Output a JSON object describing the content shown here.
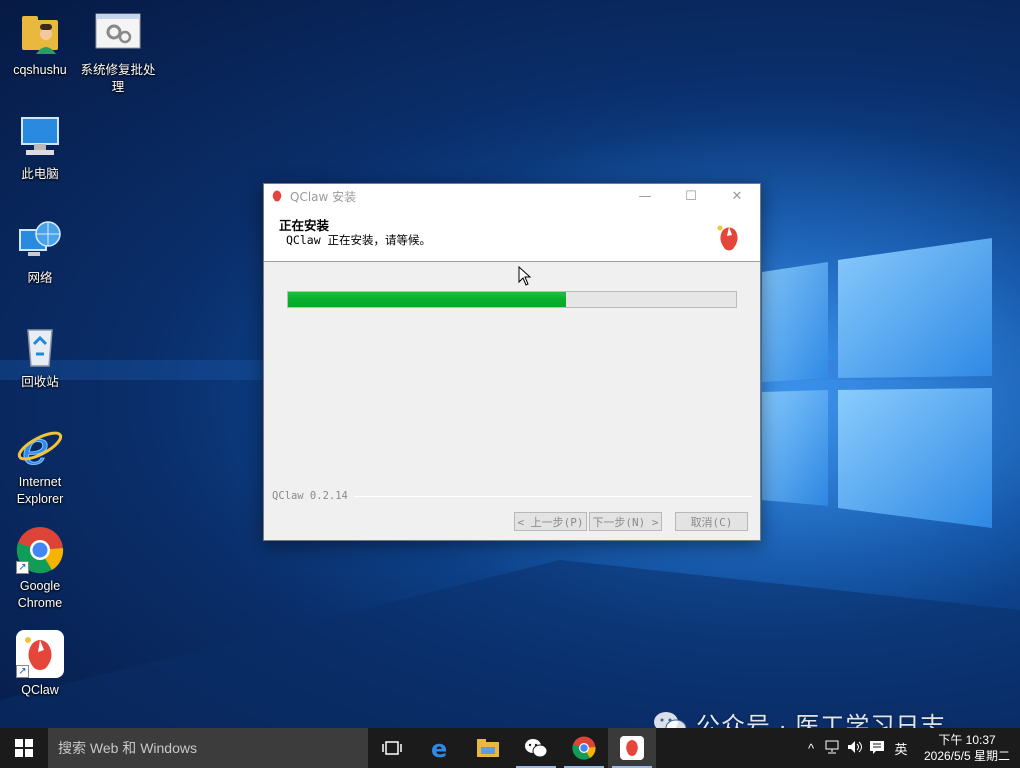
{
  "desktop": {
    "icons": [
      {
        "label": "cqshushu",
        "icon": "user-folder-icon"
      },
      {
        "label": "系统修复批处\n理",
        "icon": "batch-file-icon"
      },
      {
        "label": "此电脑",
        "icon": "computer-icon"
      },
      {
        "label": "网络",
        "icon": "network-icon"
      },
      {
        "label": "回收站",
        "icon": "recycle-bin-icon"
      },
      {
        "label": "Internet\nExplorer",
        "icon": "ie-icon"
      },
      {
        "label": "Google\nChrome",
        "icon": "chrome-icon"
      },
      {
        "label": "QClaw",
        "icon": "qclaw-icon"
      }
    ]
  },
  "dialog": {
    "title": "QClaw 安装",
    "minimize": "—",
    "maximize": "☐",
    "close": "✕",
    "header_title": "正在安装",
    "header_subtitle": "QClaw 正在安装，请等候。",
    "progress": 0.62,
    "version": "QClaw 0.2.14",
    "back_label": "< 上一步(P)",
    "next_label": "下一步(N) >",
    "cancel_label": "取消(C)"
  },
  "taskbar": {
    "search_placeholder": "搜索 Web 和 Windows",
    "apps": [
      "task-view-icon",
      "edge-icon",
      "file-explorer-icon",
      "wechat-icon",
      "chrome-icon",
      "qclaw-icon"
    ],
    "tray": {
      "chevron": "^",
      "ime": "英",
      "time": "下午 10:37",
      "date": "2026/5/5 星期二"
    }
  },
  "watermark": "公众号 · 医工学习日志",
  "colors": {
    "progress": "#06b02b",
    "taskbar": "#1b1b1b",
    "search": "#3c3c3c"
  }
}
